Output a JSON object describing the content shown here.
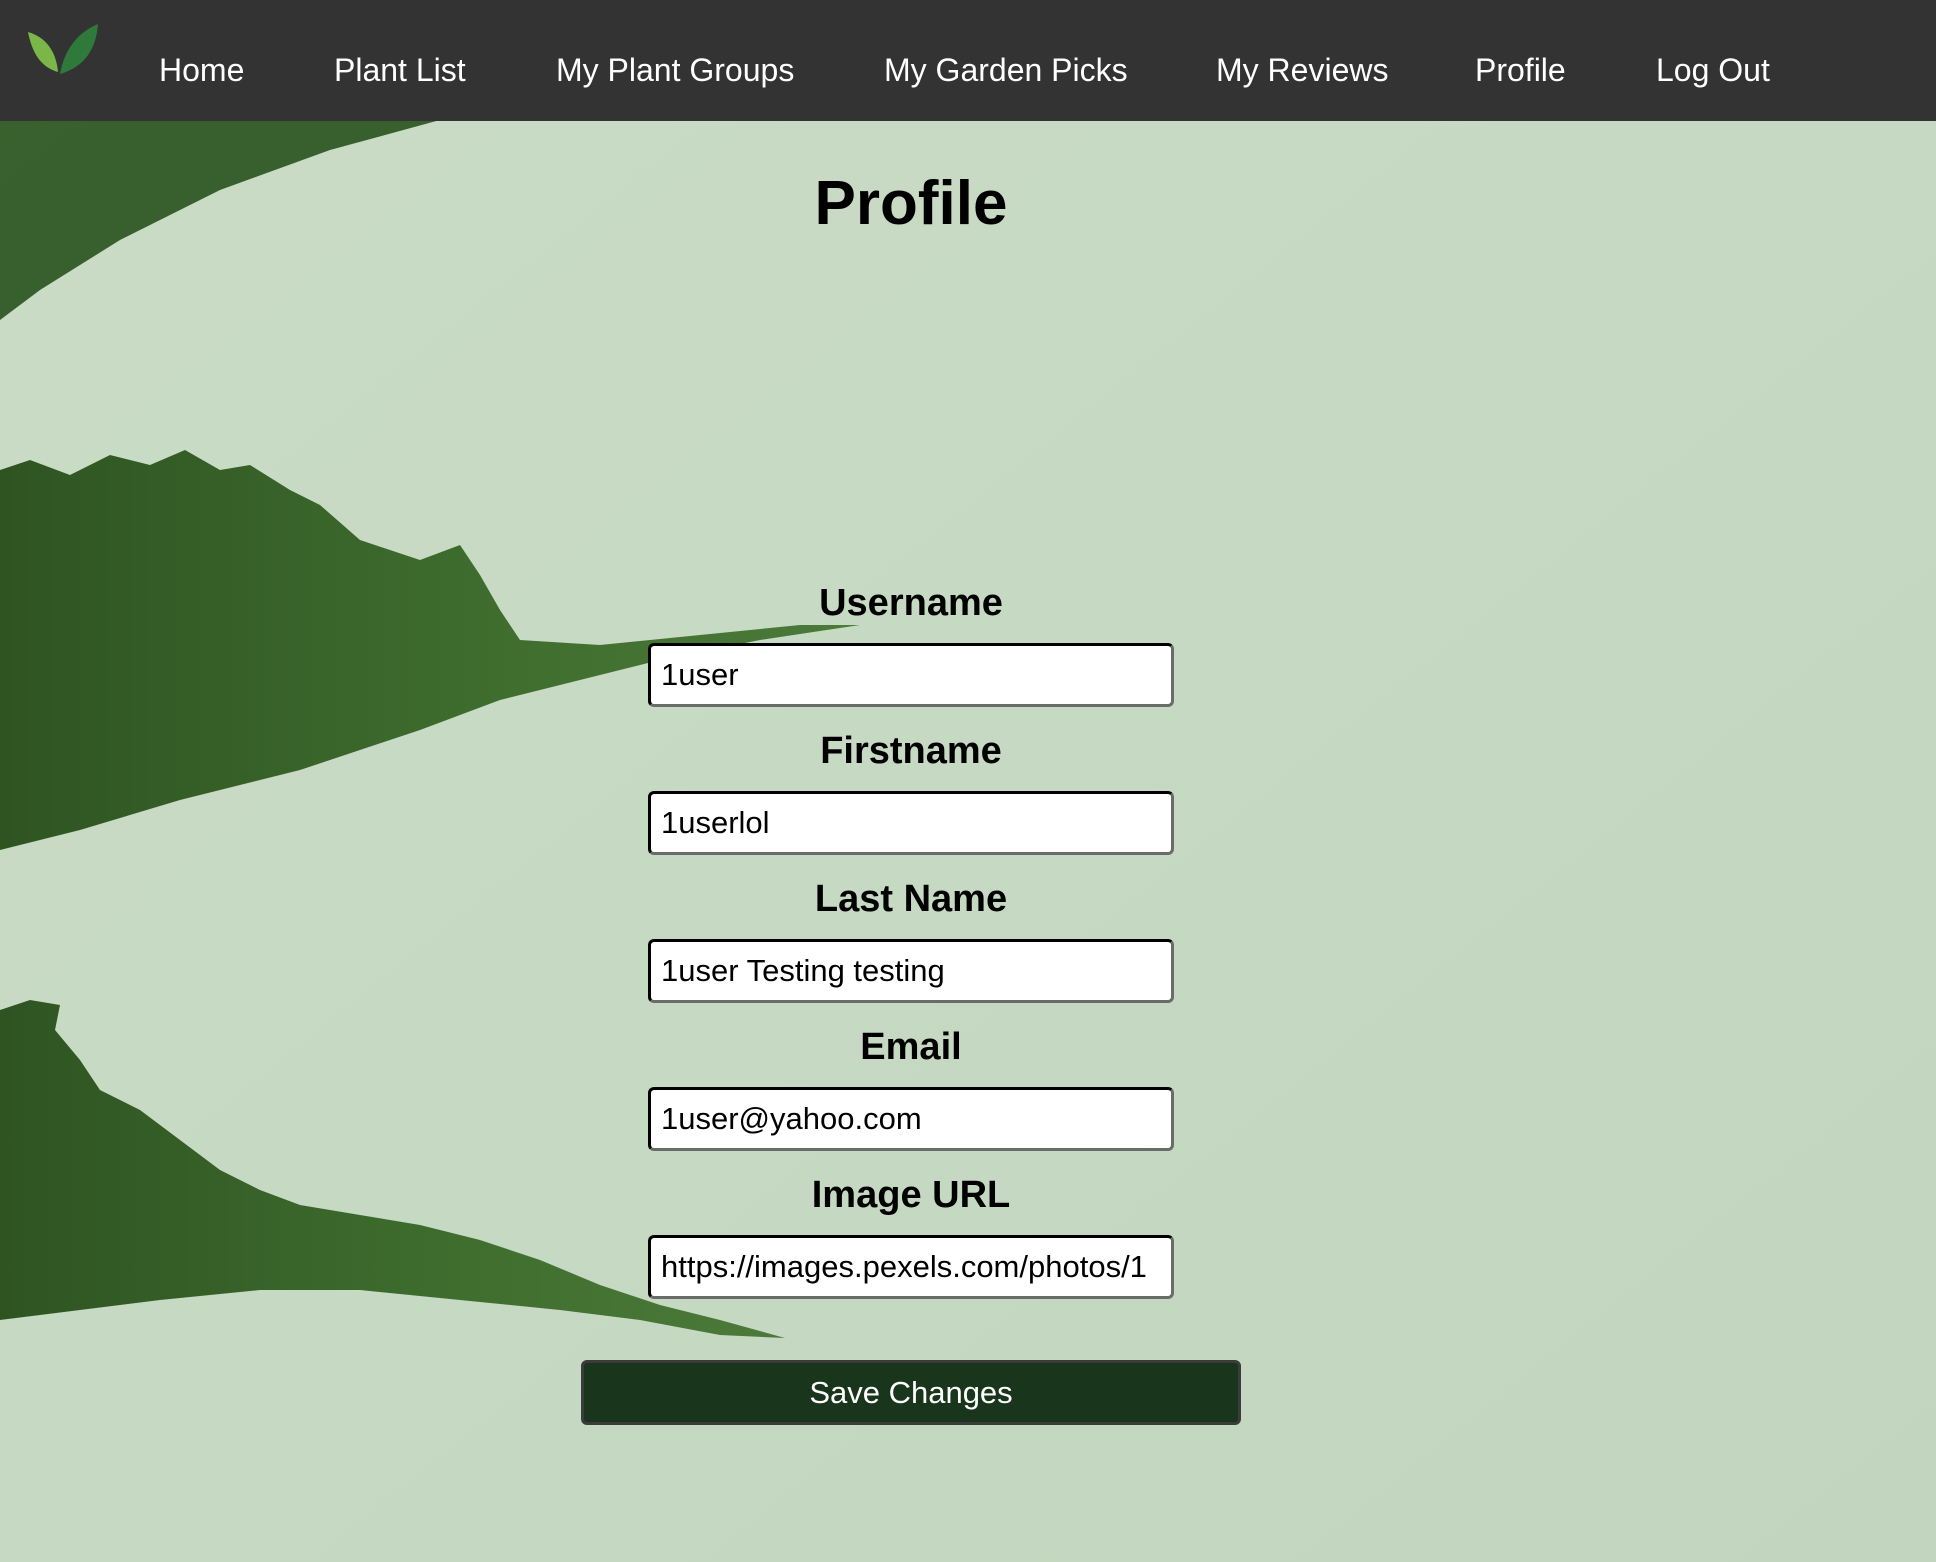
{
  "nav": {
    "logo_icon": "leaf-icon",
    "items": [
      {
        "label": "Home"
      },
      {
        "label": "Plant List"
      },
      {
        "label": "My Plant Groups"
      },
      {
        "label": "My Garden Picks"
      },
      {
        "label": "My Reviews"
      },
      {
        "label": "Profile"
      },
      {
        "label": "Log Out"
      }
    ]
  },
  "page": {
    "title": "Profile"
  },
  "form": {
    "username": {
      "label": "Username",
      "value": "1user"
    },
    "firstname": {
      "label": "Firstname",
      "value": "1userlol"
    },
    "lastname": {
      "label": "Last Name",
      "value": "1user Testing testing"
    },
    "email": {
      "label": "Email",
      "value": "1user@yahoo.com"
    },
    "image_url": {
      "label": "Image URL",
      "value": "https://images.pexels.com/photos/1"
    },
    "save_label": "Save Changes"
  },
  "colors": {
    "navbar": "#333333",
    "background": "#c9dcc5",
    "button": "#19361d",
    "leaf": "#3c6a2c"
  }
}
